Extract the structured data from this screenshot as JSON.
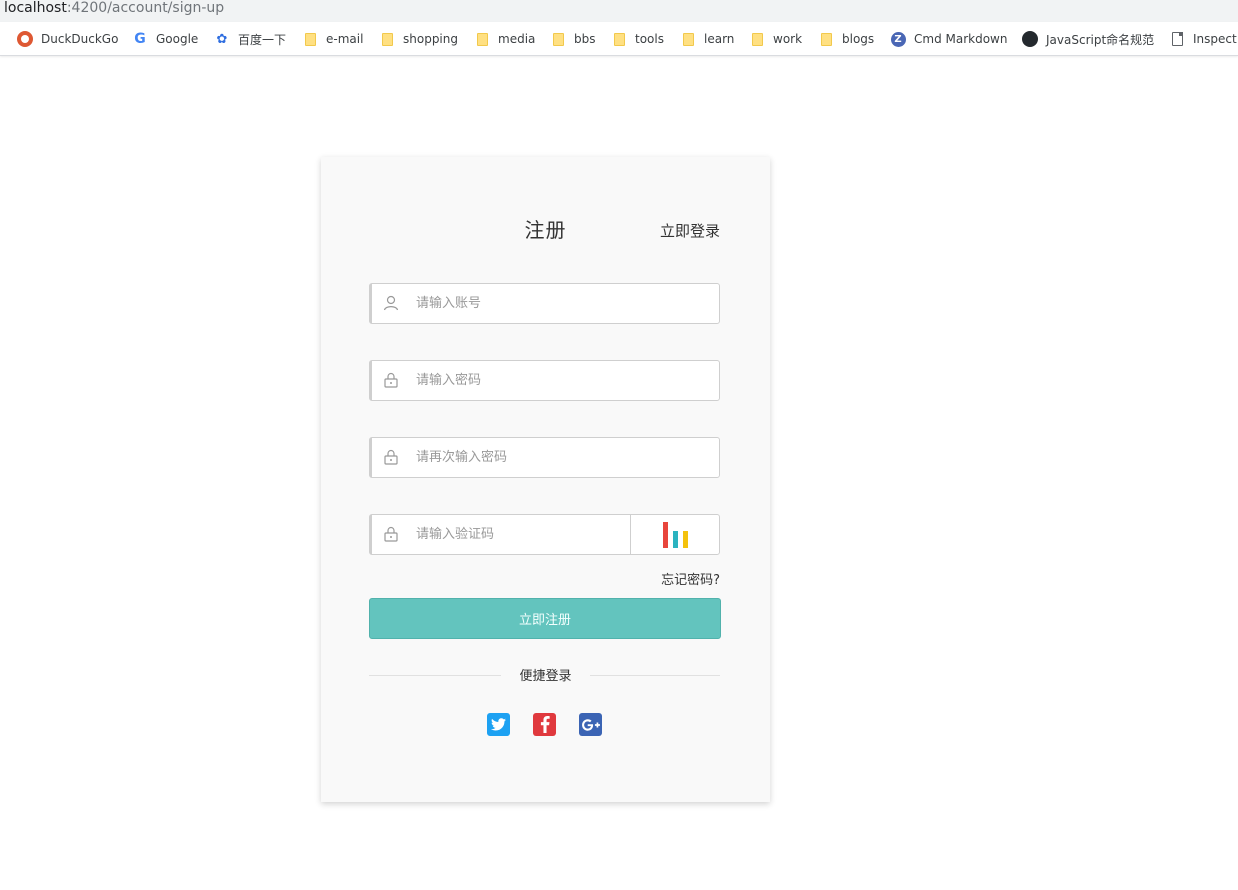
{
  "browser": {
    "url_host": "localhost",
    "url_rest": ":4200/account/sign-up",
    "bookmarks": [
      {
        "label": "DuckDuckGo",
        "icon": "duckduckgo-icon"
      },
      {
        "label": "Google",
        "icon": "google-icon"
      },
      {
        "label": "百度一下",
        "icon": "baidu-icon"
      },
      {
        "label": "e-mail",
        "icon": "folder-icon"
      },
      {
        "label": "shopping",
        "icon": "folder-icon"
      },
      {
        "label": "media",
        "icon": "folder-icon"
      },
      {
        "label": "bbs",
        "icon": "folder-icon"
      },
      {
        "label": "tools",
        "icon": "folder-icon"
      },
      {
        "label": "learn",
        "icon": "folder-icon"
      },
      {
        "label": "work",
        "icon": "folder-icon"
      },
      {
        "label": "blogs",
        "icon": "folder-icon"
      },
      {
        "label": "Cmd Markdown",
        "icon": "cmd-markdown-icon"
      },
      {
        "label": "JavaScript命名规范",
        "icon": "github-icon"
      },
      {
        "label": "Inspect",
        "icon": "page-icon"
      }
    ]
  },
  "form": {
    "title": "注册",
    "login_link": "立即登录",
    "account_placeholder": "请输入账号",
    "password_placeholder": "请输入密码",
    "confirm_placeholder": "请再次输入密码",
    "captcha_placeholder": "请输入验证码",
    "captcha_colors": [
      "#e8453c",
      "#2bb3c0",
      "#f4c20d"
    ],
    "forgot": "忘记密码?",
    "submit": "立即注册",
    "quick_login": "便捷登录",
    "social_colors": {
      "twitter": "#1da1f2",
      "facebook": "#e0393e",
      "google_plus": "#3b64b4"
    }
  }
}
